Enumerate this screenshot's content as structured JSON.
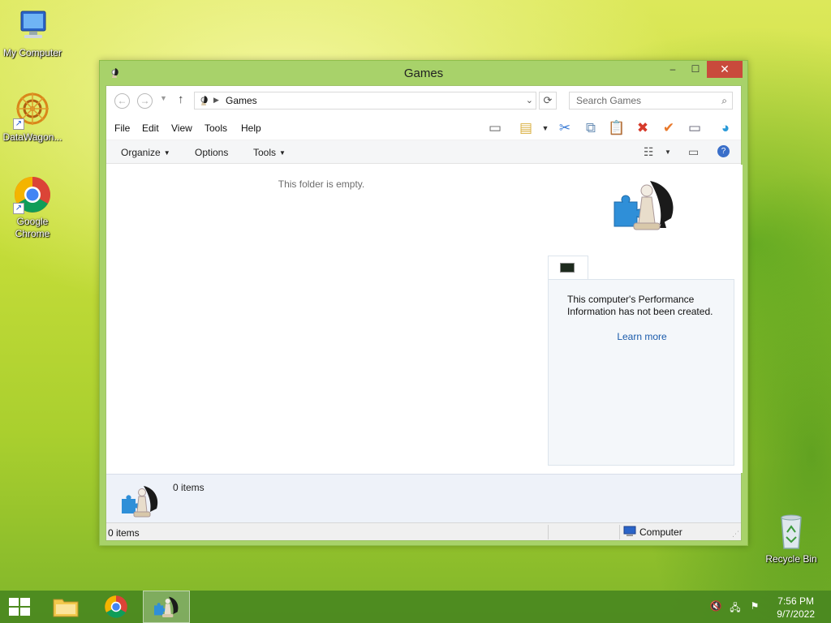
{
  "desktop": {
    "icons": [
      {
        "label": "My Computer",
        "icon": "computer-icon"
      },
      {
        "label": "DataWagon...",
        "icon": "datawagon-icon"
      },
      {
        "label": "Google Chrome",
        "icon": "chrome-icon"
      },
      {
        "label": "Recycle Bin",
        "icon": "recycle-bin-icon"
      }
    ]
  },
  "window": {
    "title": "Games",
    "controls": {
      "minimize": "–",
      "maximize": "☐",
      "close": "✕"
    }
  },
  "address": {
    "path": "Games",
    "search_placeholder": "Search Games"
  },
  "menu": {
    "items": [
      "File",
      "Edit",
      "View",
      "Tools",
      "Help"
    ]
  },
  "commandbar": {
    "organize": "Organize",
    "options": "Options",
    "tools": "Tools"
  },
  "content": {
    "empty_message": "This folder is empty."
  },
  "sidepane": {
    "performance_text": "This computer's Performance Information has not been created.",
    "learn_more": "Learn more"
  },
  "details": {
    "count": "0 items"
  },
  "statusbar": {
    "left": "0 items",
    "right": "Computer"
  },
  "taskbar": {
    "time": "7:56 PM",
    "date": "9/7/2022"
  },
  "colors": {
    "close_button": "#c94a3c",
    "window_frame": "#a8d26a",
    "taskbar": "#4a8820",
    "link": "#1a5bab"
  }
}
